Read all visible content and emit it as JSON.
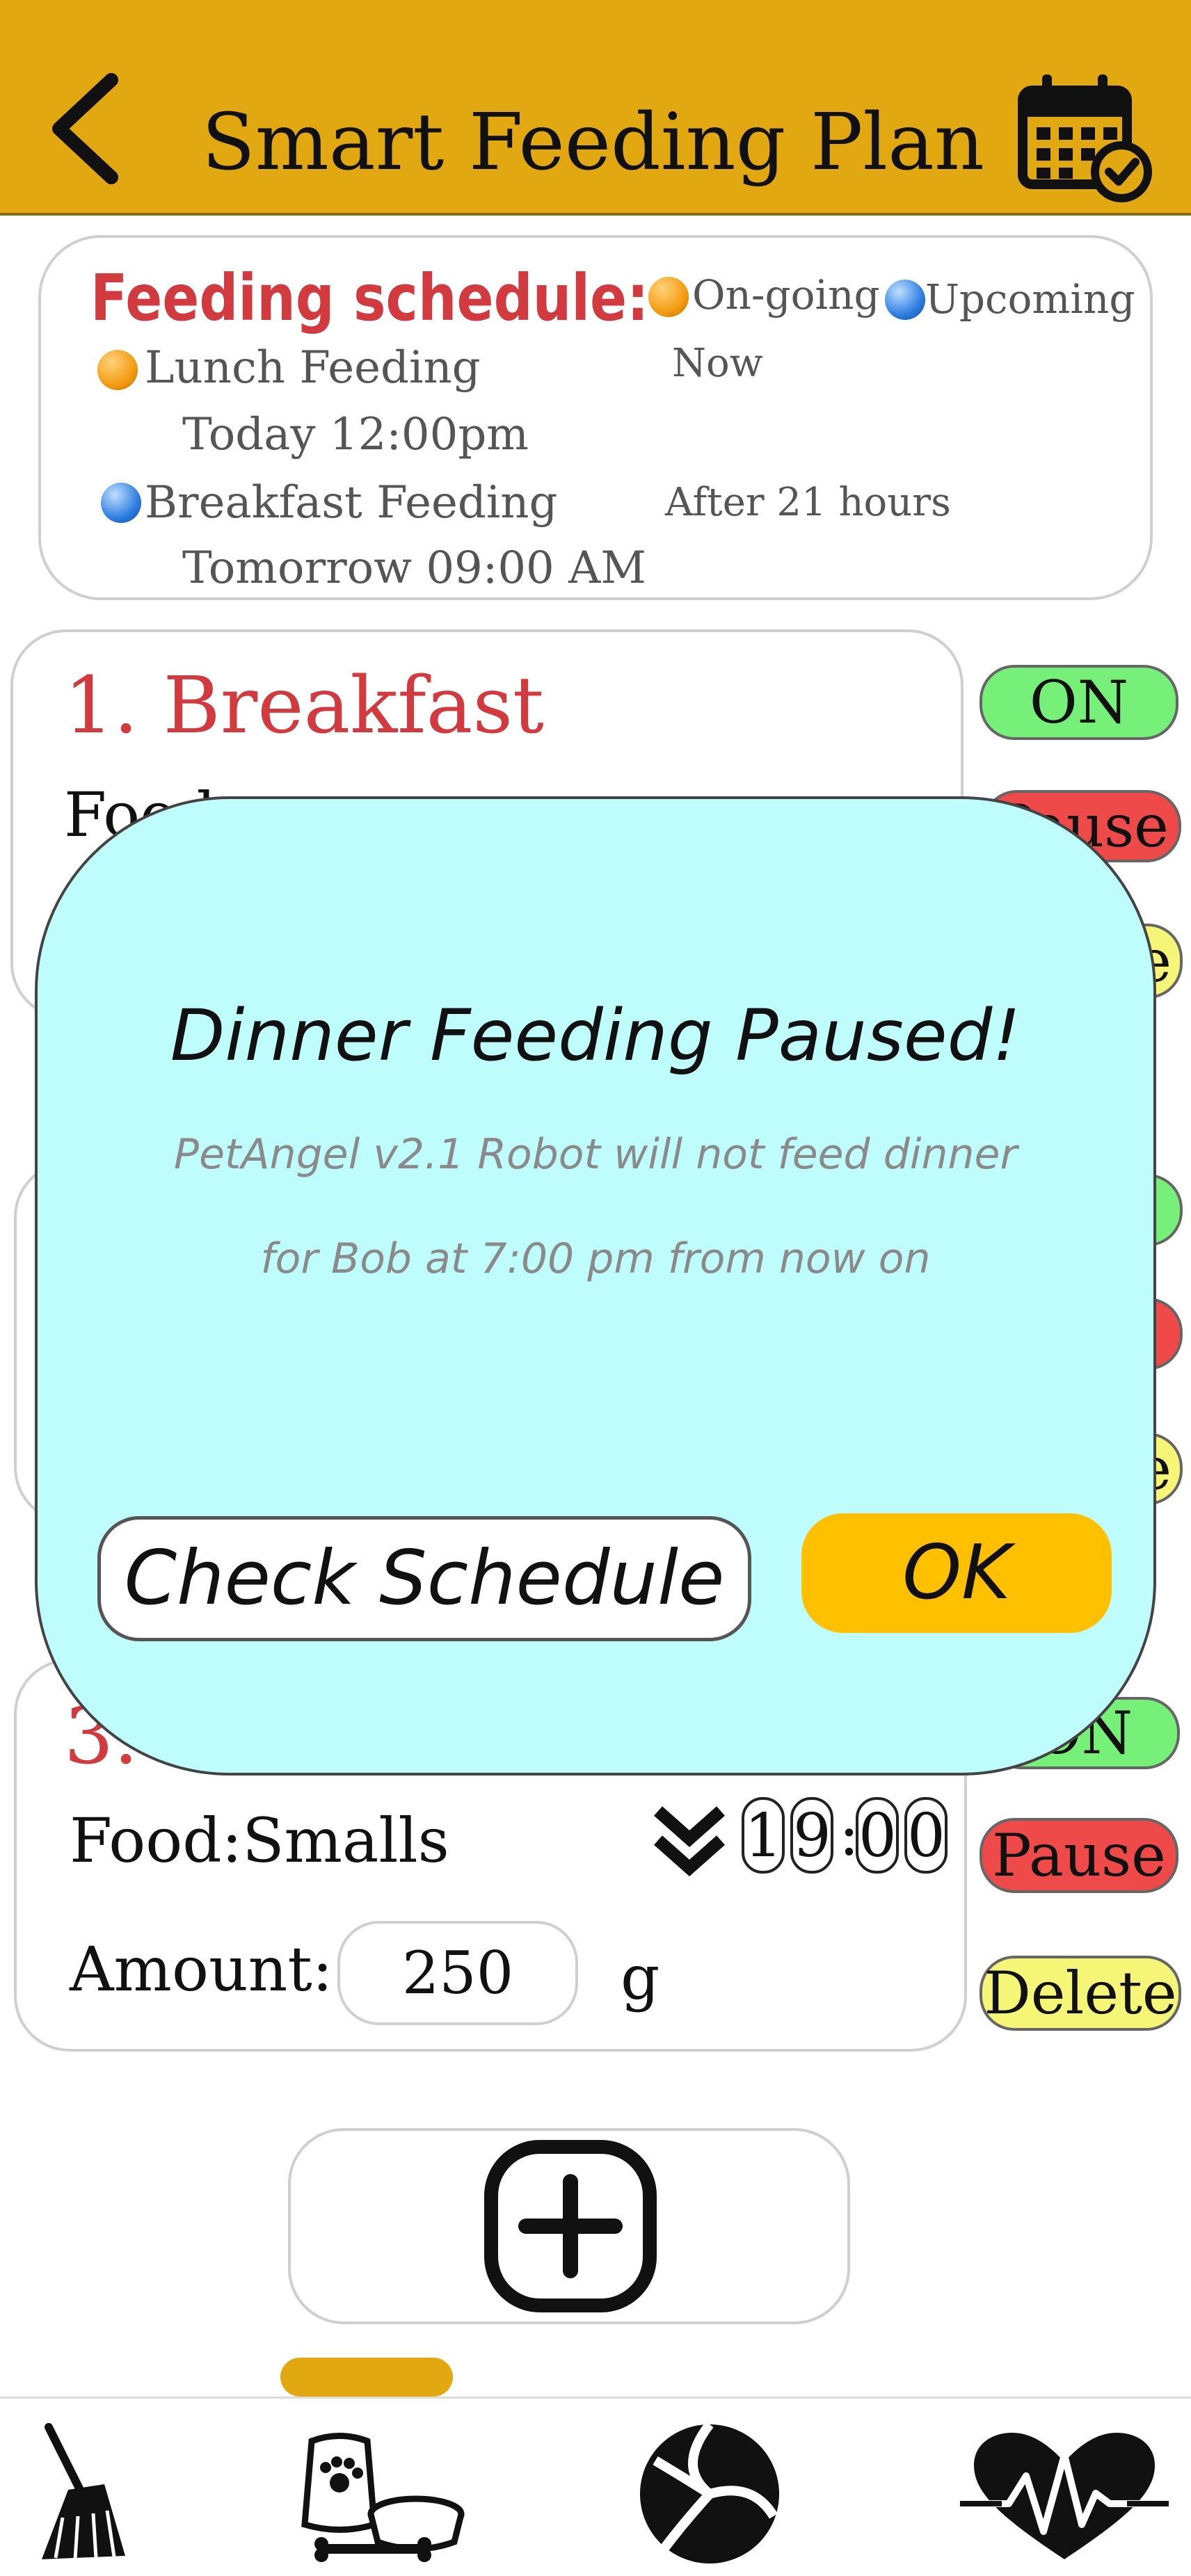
{
  "header": {
    "title": "Smart Feeding Plan",
    "back_icon": "chevron-left-icon",
    "calendar_icon": "calendar-check-icon",
    "color": "#e2a812"
  },
  "schedule": {
    "title": "Feeding schedule:",
    "legend": [
      {
        "label": "On-going",
        "color": "orange"
      },
      {
        "label": "Upcoming",
        "color": "blue"
      }
    ],
    "items": [
      {
        "name": "Lunch Feeding",
        "time": "Today 12:00pm",
        "status": "Now",
        "color": "orange"
      },
      {
        "name": "Breakfast Feeding",
        "time": "Tomorrow 09:00 AM",
        "status": "After 21 hours",
        "color": "blue"
      }
    ]
  },
  "plans": [
    {
      "title": "1. Breakfast",
      "food_label": "Food",
      "controls": {
        "on": "ON",
        "pause": "Pause",
        "delete": "e"
      }
    },
    {
      "controls": {
        "on": "",
        "pause": "",
        "delete": "e"
      }
    },
    {
      "title": "3. D",
      "food_label": "Food:Smalls",
      "time_digits": [
        "1",
        "9",
        "0",
        "0"
      ],
      "amount_label": "Amount:",
      "amount_value": "250",
      "unit": "g",
      "controls": {
        "on": "ON",
        "pause": "Pause",
        "delete": "Delete"
      }
    }
  ],
  "add_button": {
    "icon": "plus-square-icon"
  },
  "bottom_nav": {
    "items": [
      {
        "icon": "broom-icon"
      },
      {
        "icon": "pet-food-icon"
      },
      {
        "icon": "ball-icon"
      },
      {
        "icon": "heartbeat-icon"
      }
    ],
    "active_index": 1
  },
  "modal": {
    "title": "Dinner Feeding Paused!",
    "message_line1": "PetAngel v2.1 Robot will not feed dinner",
    "message_line2": "for Bob at 7:00 pm from now on",
    "check_button": "Check Schedule",
    "ok_button": "OK",
    "background": "#bffdfc",
    "ok_color": "#ffc000"
  }
}
